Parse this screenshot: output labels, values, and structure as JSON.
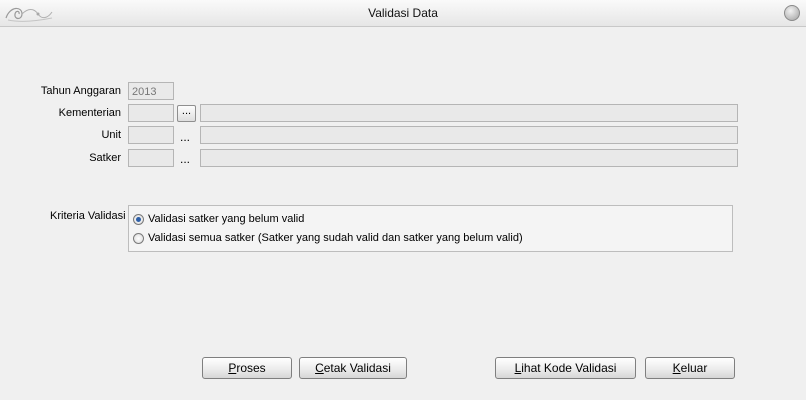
{
  "window": {
    "title": "Validasi Data"
  },
  "form": {
    "tahun_label": "Tahun Anggaran",
    "tahun_value": "2013",
    "kementerian_label": "Kementerian",
    "unit_label": "Unit",
    "satker_label": "Satker",
    "browse_label": "..."
  },
  "kriteria": {
    "label": "Kriteria Validasi",
    "options": [
      {
        "label": "Validasi satker yang belum valid",
        "selected": true
      },
      {
        "label": "Validasi semua satker (Satker yang sudah valid dan satker yang belum valid)",
        "selected": false
      }
    ]
  },
  "buttons": {
    "proses": {
      "mnemonic": "P",
      "rest": "roses"
    },
    "cetak": {
      "mnemonic": "C",
      "rest": "etak Validasi"
    },
    "lihat": {
      "mnemonic": "L",
      "rest": "ihat Kode Validasi"
    },
    "keluar": {
      "mnemonic": "K",
      "rest": "eluar"
    }
  },
  "colors": {
    "radio_selected": "#2d5fa8",
    "field_bg": "#e9e9e9",
    "window_bg": "#f0f0f0"
  }
}
